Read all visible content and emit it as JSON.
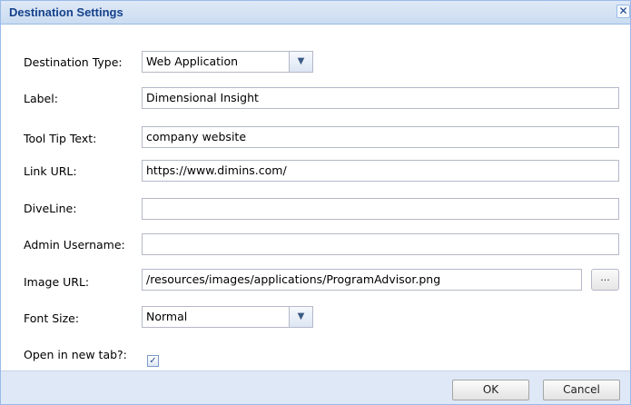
{
  "dialog": {
    "title": "Destination Settings",
    "close_glyph": "✕"
  },
  "form": {
    "destination_type": {
      "label": "Destination Type:",
      "value": "Web Application"
    },
    "label_field": {
      "label": "Label:",
      "value": "Dimensional Insight"
    },
    "tooltip": {
      "label": "Tool Tip Text:",
      "value": "company website"
    },
    "link_url": {
      "label": "Link URL:",
      "value": "https://www.dimins.com/"
    },
    "diveline": {
      "label": "DiveLine:",
      "value": ""
    },
    "admin_username": {
      "label": "Admin Username:",
      "value": ""
    },
    "image_url": {
      "label": "Image URL:",
      "value": "/resources/images/applications/ProgramAdvisor.png",
      "browse_label": "..."
    },
    "font_size": {
      "label": "Font Size:",
      "value": "Normal"
    },
    "open_new_tab": {
      "label": "Open in new tab?:",
      "checked": true,
      "check_glyph": "✓"
    }
  },
  "footer": {
    "ok_label": "OK",
    "cancel_label": "Cancel"
  },
  "icons": {
    "dropdown": "chevron-down-icon",
    "close": "close-icon",
    "check": "checkmark-icon"
  },
  "colors": {
    "title_text": "#15428b",
    "titlebar_bg": "#dfe9f6",
    "footer_bg": "#dfe8f6",
    "field_border": "#b5b8c8"
  }
}
